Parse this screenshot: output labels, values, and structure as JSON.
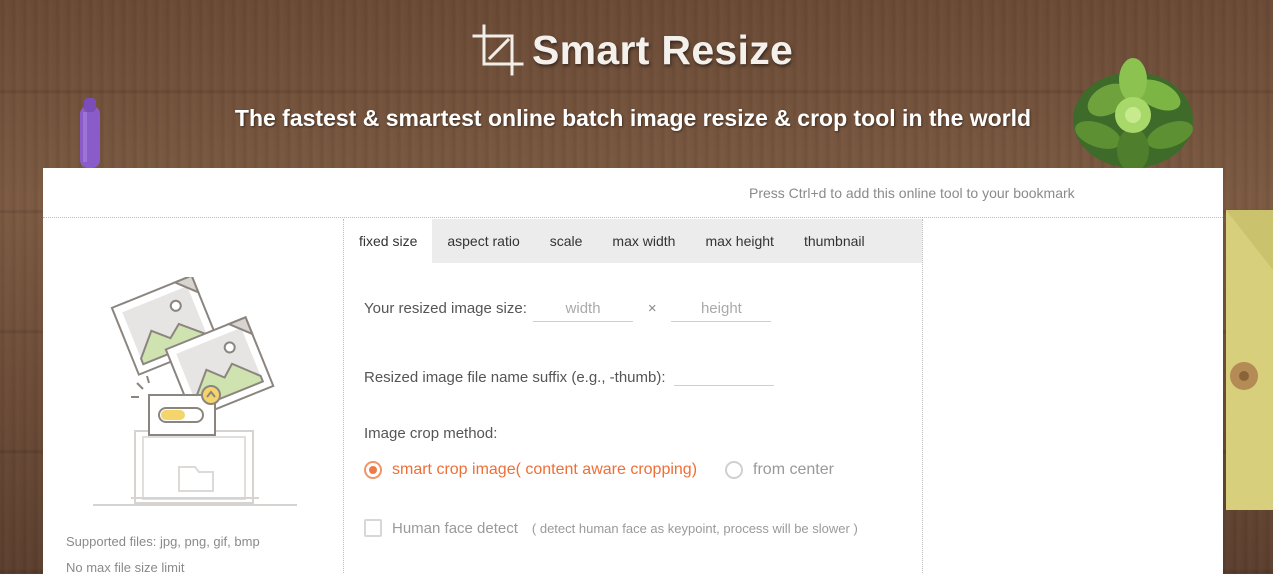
{
  "header": {
    "app_name": "Smart Resize",
    "tagline": "The fastest & smartest online batch image resize & crop tool in the world"
  },
  "bookmark_hint": "Press Ctrl+d to add this online tool to your bookmark",
  "upload_panel": {
    "supported_files": "Supported files: jpg, png, gif, bmp",
    "size_limit": "No max file size limit"
  },
  "tabs": [
    {
      "label": "fixed size",
      "active": true
    },
    {
      "label": "aspect ratio",
      "active": false
    },
    {
      "label": "scale",
      "active": false
    },
    {
      "label": "max width",
      "active": false
    },
    {
      "label": "max height",
      "active": false
    },
    {
      "label": "thumbnail",
      "active": false
    }
  ],
  "form": {
    "size_label": "Your resized image size:",
    "width_placeholder": "width",
    "times_symbol": "×",
    "height_placeholder": "height",
    "suffix_label": "Resized image file name suffix (e.g., -thumb):",
    "suffix_value": "",
    "crop_method_label": "Image crop method:",
    "crop_options": [
      {
        "label": "smart crop image( content aware cropping)",
        "selected": true
      },
      {
        "label": "from center",
        "selected": false
      }
    ],
    "face_detect_label": "Human face detect",
    "face_detect_note": "( detect human face as keypoint, process will be slower )",
    "face_detect_checked": false
  },
  "colors": {
    "accent": "#ee6f36",
    "card_bg": "#ffffff",
    "tab_bar_bg": "#ececec"
  },
  "icons": {
    "logo": "crop-icon",
    "illustration": "upload-images-illustration"
  }
}
